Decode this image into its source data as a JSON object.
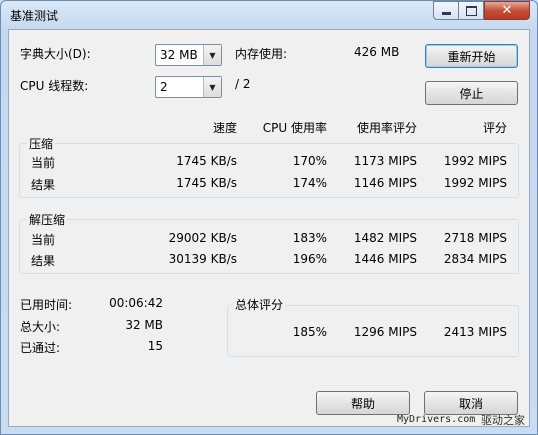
{
  "window": {
    "title": "基准测试"
  },
  "settings": {
    "dict_label": "字典大小(D):",
    "dict_value": "32 MB",
    "mem_label": "内存使用:",
    "mem_value": "426 MB",
    "threads_label": "CPU 线程数:",
    "threads_value": "2",
    "threads_total": "/ 2"
  },
  "buttons": {
    "restart": "重新开始",
    "stop": "停止",
    "help": "帮助",
    "cancel": "取消"
  },
  "columns": {
    "speed": "速度",
    "cpu_usage": "CPU 使用率",
    "rating_usage": "使用率评分",
    "rating": "评分"
  },
  "compress": {
    "label": "压缩",
    "rows": [
      {
        "name": "当前",
        "speed": "1745 KB/s",
        "cpu": "170%",
        "rating_usage": "1173 MIPS",
        "rating": "1992 MIPS"
      },
      {
        "name": "结果",
        "speed": "1745 KB/s",
        "cpu": "174%",
        "rating_usage": "1146 MIPS",
        "rating": "1992 MIPS"
      }
    ]
  },
  "decompress": {
    "label": "解压缩",
    "rows": [
      {
        "name": "当前",
        "speed": "29002 KB/s",
        "cpu": "183%",
        "rating_usage": "1482 MIPS",
        "rating": "2718 MIPS"
      },
      {
        "name": "结果",
        "speed": "30139 KB/s",
        "cpu": "196%",
        "rating_usage": "1446 MIPS",
        "rating": "2834 MIPS"
      }
    ]
  },
  "stats": {
    "elapsed_label": "已用时间:",
    "elapsed_value": "00:06:42",
    "size_label": "总大小:",
    "size_value": "32 MB",
    "passes_label": "已通过:",
    "passes_value": "15"
  },
  "overall": {
    "label": "总体评分",
    "cpu": "185%",
    "rating_usage": "1296 MIPS",
    "rating": "2413 MIPS"
  },
  "watermark": {
    "site": "MyDrivers.com",
    "brand": "驱动之家"
  }
}
